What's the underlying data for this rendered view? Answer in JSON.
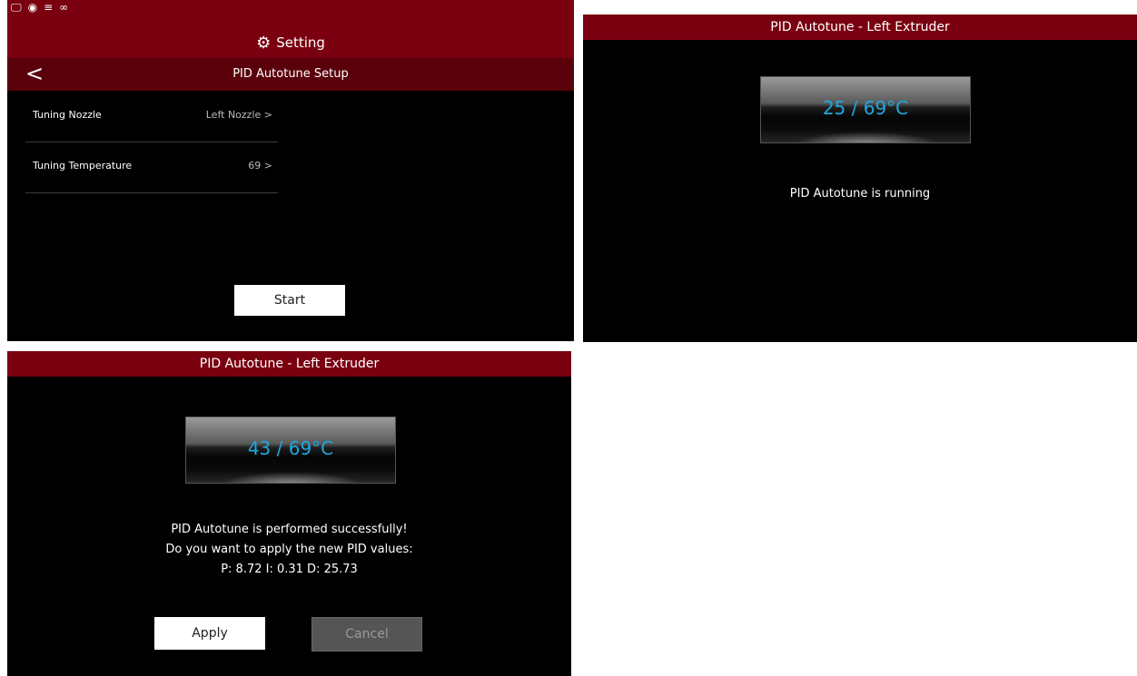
{
  "caption": "... ... Apply ... ...",
  "panel1": {
    "header": {
      "title": "Setting",
      "back_symbol": "<"
    },
    "subheader": {
      "title": "PID Autotune Setup"
    },
    "rows": [
      {
        "label": "Tuning Nozzle",
        "value": "Left Nozzle >"
      },
      {
        "label": "Tuning Temperature",
        "value": "69 >"
      }
    ],
    "start_label": "Start"
  },
  "panel2": {
    "title": "PID Autotune - Left Extruder",
    "temperature": "25 / 69°C",
    "message": "PID Autotune is running"
  },
  "panel3": {
    "title": "PID Autotune - Left Extruder",
    "temperature": "43 / 69°C",
    "message_line1": "PID Autotune is performed successfully!",
    "message_line2": "Do you want to apply the new PID values:",
    "message_line3": "P: 8.72  I: 0.31  D: 25.73",
    "apply_label": "Apply",
    "cancel_label": "Cancel"
  },
  "icons": [
    "monitor-icon",
    "webcam-icon",
    "network-icon",
    "link-icon",
    "gear-icon",
    "back-arrow-icon"
  ],
  "colors": {
    "accent_red": "#7a0010",
    "temp_blue": "#1fa8e0"
  }
}
